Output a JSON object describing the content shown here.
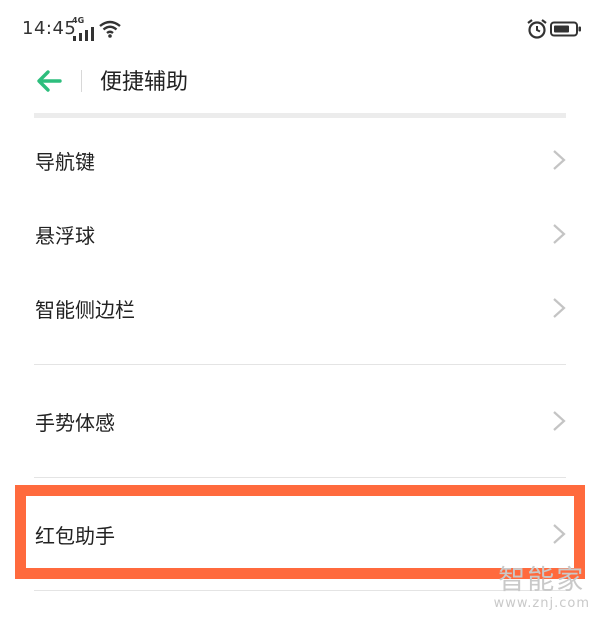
{
  "status_bar": {
    "time": "14:45",
    "network": "4G"
  },
  "header": {
    "title": "便捷辅助"
  },
  "menu": {
    "items": [
      {
        "label": "导航键"
      },
      {
        "label": "悬浮球"
      },
      {
        "label": "智能侧边栏"
      },
      {
        "label": "手势体感"
      },
      {
        "label": "红包助手"
      }
    ]
  },
  "watermark": {
    "text": "智能家",
    "url": "www.znj.com"
  },
  "colors": {
    "accent": "#2dbe7d",
    "highlight": "#ff6a3d"
  }
}
